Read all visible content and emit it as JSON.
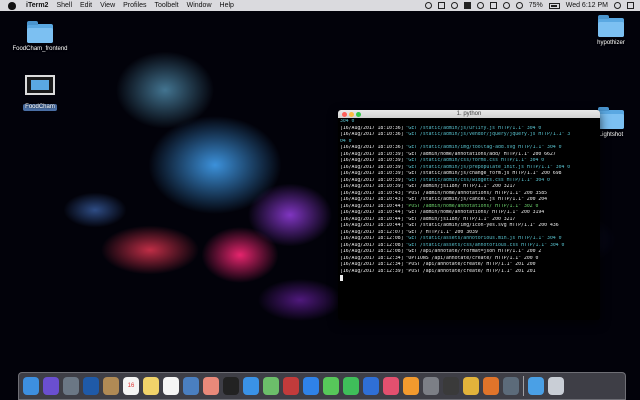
{
  "menubar": {
    "app_name": "iTerm2",
    "menus": [
      "Shell",
      "Edit",
      "View",
      "Profiles",
      "Toolbelt",
      "Window",
      "Help"
    ],
    "battery": "75%",
    "clock": "Wed 6:12 PM"
  },
  "desktop": {
    "icons": [
      {
        "label": "FoodCham_frontend",
        "icon": "folder-icon"
      },
      {
        "label": "FoodCham",
        "icon": "screenshot-thumbnail-icon",
        "selected": true
      },
      {
        "label": "hypothizer",
        "icon": "folder-icon"
      },
      {
        "label": "Lightshot",
        "icon": "folder-icon"
      }
    ]
  },
  "terminal": {
    "title": "1. python",
    "lines": [
      {
        "ts": "",
        "text": "304 0",
        "color": "#58c2ce"
      },
      {
        "ts": "[16/Aug/2017 18:10:36]",
        "text": "\"GET /static/admin/js/urlify.js HTTP/1.1\" 304 0",
        "color": "#58c2ce"
      },
      {
        "ts": "[16/Aug/2017 18:10:36]",
        "text": "\"GET /static/admin/js/vendor/jquery/jquery.js HTTP/1.1\" 3",
        "color": "#58c2ce"
      },
      {
        "ts": "",
        "text": "04 0",
        "color": "#58c2ce"
      },
      {
        "ts": "[16/Aug/2017 18:10:36]",
        "text": "\"GET /static/admin/img/tooltag-add.svg HTTP/1.1\" 304 0",
        "color": "#58c2ce"
      },
      {
        "ts": "[16/Aug/2017 18:10:39]",
        "text": "\"GET /admin/home/annotations/add/ HTTP/1.1\" 200 6627",
        "color": "#ededed"
      },
      {
        "ts": "[16/Aug/2017 18:10:39]",
        "text": "\"GET /static/admin/css/forms.css HTTP/1.1\" 304 0",
        "color": "#58c2ce"
      },
      {
        "ts": "[16/Aug/2017 18:10:39]",
        "text": "\"GET /static/admin/js/prepopulate_init.js HTTP/1.1\" 304 0",
        "color": "#58c2ce"
      },
      {
        "ts": "[16/Aug/2017 18:10:39]",
        "text": "\"GET /static/admin/js/change_form.js HTTP/1.1\" 200 698",
        "color": "#ededed"
      },
      {
        "ts": "[16/Aug/2017 18:10:39]",
        "text": "\"GET /static/admin/css/widgets.css HTTP/1.1\" 304 0",
        "color": "#58c2ce"
      },
      {
        "ts": "[16/Aug/2017 18:10:39]",
        "text": "\"GET /admin/jsi18n/ HTTP/1.1\" 200 3217",
        "color": "#ededed"
      },
      {
        "ts": "[16/Aug/2017 18:10:43]",
        "text": "\"POST /admin/home/annotations/ HTTP/1.1\" 200 3585",
        "color": "#ededed"
      },
      {
        "ts": "[16/Aug/2017 18:10:43]",
        "text": "\"GET /static/admin/js/cancel.js HTTP/1.1\" 200 204",
        "color": "#ededed"
      },
      {
        "ts": "[16/Aug/2017 18:10:44]",
        "text": "\"POST /admin/home/annotations/ HTTP/1.1\" 302 0",
        "color": "#6cd26c"
      },
      {
        "ts": "[16/Aug/2017 18:10:44]",
        "text": "\"GET /admin/home/annotations/ HTTP/1.1\" 200 3194",
        "color": "#ededed"
      },
      {
        "ts": "[16/Aug/2017 18:10:44]",
        "text": "\"GET /admin/jsi18n/ HTTP/1.1\" 200 3217",
        "color": "#ededed"
      },
      {
        "ts": "[16/Aug/2017 18:10:44]",
        "text": "\"GET /static/admin/img/icon-yes.svg HTTP/1.1\" 200 436",
        "color": "#ededed"
      },
      {
        "ts": "[16/Aug/2017 18:12:07]",
        "text": "\"GET / HTTP/1.1\" 200 3039",
        "color": "#ededed"
      },
      {
        "ts": "[16/Aug/2017 18:12:08]",
        "text": "\"GET /static/assets/annotorious.min.js HTTP/1.1\" 304 0",
        "color": "#58c2ce"
      },
      {
        "ts": "[16/Aug/2017 18:12:08]",
        "text": "\"GET /static/assets/css/annotorious.css HTTP/1.1\" 304 0",
        "color": "#58c2ce"
      },
      {
        "ts": "[16/Aug/2017 18:12:08]",
        "text": "\"GET /api/annotate/?format=json HTTP/1.1\" 200 2",
        "color": "#ededed"
      },
      {
        "ts": "[16/Aug/2017 18:12:34]",
        "text": "\"OPTIONS /api/annotate/create/ HTTP/1.1\" 200 0",
        "color": "#ededed"
      },
      {
        "ts": "[16/Aug/2017 18:12:34]",
        "text": "\"POST /api/annotate/create/ HTTP/1.1\" 201 200",
        "color": "#ededed"
      },
      {
        "ts": "[16/Aug/2017 18:12:39]",
        "text": "\"POST /api/annotate/create/ HTTP/1.1\" 201 201",
        "color": "#ededed"
      }
    ]
  },
  "dock": {
    "items": [
      {
        "name": "finder-icon",
        "color": "#3d8fe0",
        "label": ""
      },
      {
        "name": "siri-icon",
        "color": "#6a4fd0",
        "label": ""
      },
      {
        "name": "launchpad-icon",
        "color": "#6b7785",
        "label": ""
      },
      {
        "name": "safari-icon-alt",
        "color": "#1f5aa8",
        "label": ""
      },
      {
        "name": "contacts-icon",
        "color": "#b08a55",
        "label": ""
      },
      {
        "name": "calendar-icon",
        "color": "#f4f4f4",
        "label": "16"
      },
      {
        "name": "notes-icon",
        "color": "#f1d36a",
        "label": ""
      },
      {
        "name": "reminders-icon",
        "color": "#f5f5f5",
        "label": ""
      },
      {
        "name": "preview-icon",
        "color": "#4a7fc0",
        "label": ""
      },
      {
        "name": "photos-icon",
        "color": "#e9897a",
        "label": ""
      },
      {
        "name": "terminal-icon",
        "color": "#222222",
        "label": ""
      },
      {
        "name": "safari-icon",
        "color": "#3a92e6",
        "label": ""
      },
      {
        "name": "maps-icon",
        "color": "#6cbf6a",
        "label": ""
      },
      {
        "name": "photo-booth-icon",
        "color": "#c23b3b",
        "label": ""
      },
      {
        "name": "app-store-icon",
        "color": "#2f82e8",
        "label": ""
      },
      {
        "name": "messages-icon",
        "color": "#57c85a",
        "label": ""
      },
      {
        "name": "facetime-icon",
        "color": "#3fbf5a",
        "label": ""
      },
      {
        "name": "keynote-icon",
        "color": "#2f6fd6",
        "label": ""
      },
      {
        "name": "itunes-icon",
        "color": "#e3506f",
        "label": ""
      },
      {
        "name": "ibooks-icon",
        "color": "#f29a2e",
        "label": ""
      },
      {
        "name": "system-preferences-icon",
        "color": "#7c7f86",
        "label": ""
      },
      {
        "name": "activity-monitor-icon",
        "color": "#3a3a3a",
        "label": ""
      },
      {
        "name": "chrome-icon",
        "color": "#e2b33b",
        "label": ""
      },
      {
        "name": "sublime-text-icon",
        "color": "#e0742a",
        "label": ""
      },
      {
        "name": "utility-icon",
        "color": "#5c6b7a",
        "label": ""
      },
      {
        "name": "downloads-folder-icon",
        "color": "#4aa0e6",
        "label": ""
      },
      {
        "name": "trash-icon",
        "color": "#c9ced6",
        "label": ""
      }
    ],
    "separator_index": 25
  }
}
